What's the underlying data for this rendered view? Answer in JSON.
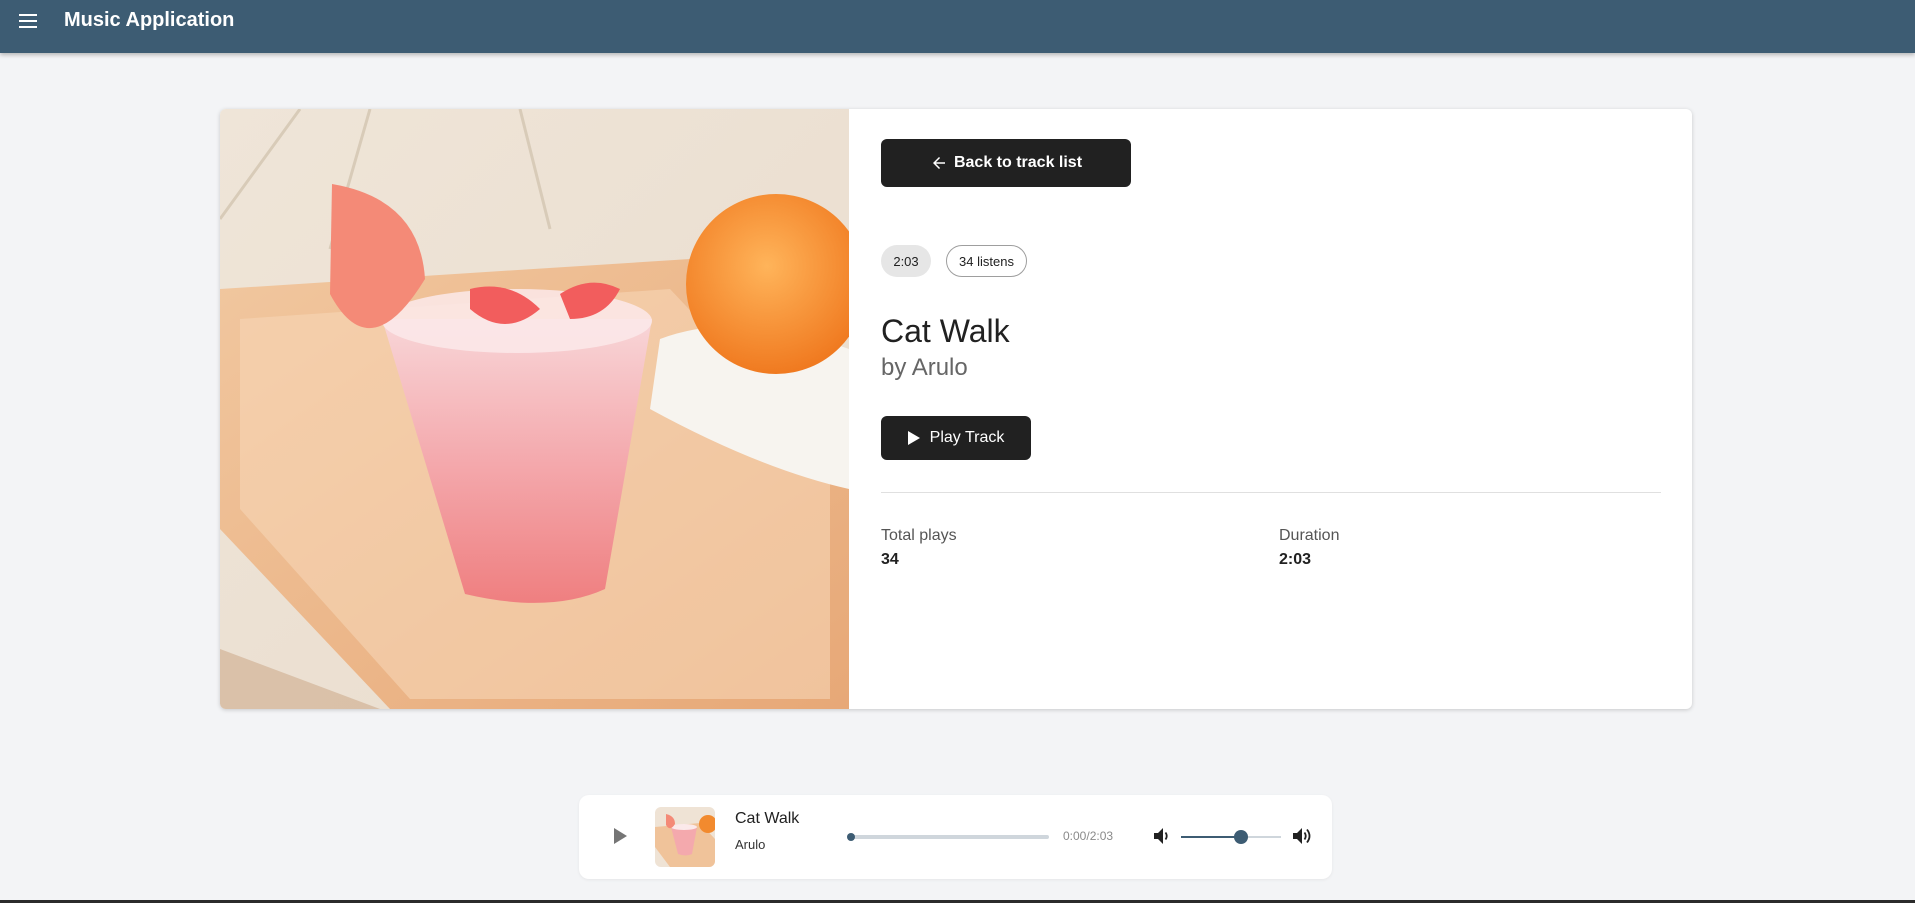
{
  "app": {
    "title": "Music Application"
  },
  "theme": {
    "primary": "#3d5c73",
    "button_dark": "#212121",
    "background": "#f3f4f6"
  },
  "icons": {
    "menu": "menu-icon",
    "back": "arrow-left-icon",
    "play": "play-icon",
    "volume_down": "volume-down-icon",
    "volume_up": "volume-up-icon"
  },
  "track": {
    "back_label": "Back to track list",
    "duration_chip": "2:03",
    "listens_chip": "34 listens",
    "title": "Cat Walk",
    "artist_line": "by Arulo",
    "play_label": "Play Track",
    "cover_alt": "Pink grapefruit drink on a wooden tray",
    "stats": [
      {
        "label": "Total plays",
        "value": "34"
      },
      {
        "label": "Duration",
        "value": "2:03"
      }
    ]
  },
  "player": {
    "title": "Cat Walk",
    "artist": "Arulo",
    "time": "0:00/2:03",
    "progress": 0,
    "volume": 0.6
  }
}
